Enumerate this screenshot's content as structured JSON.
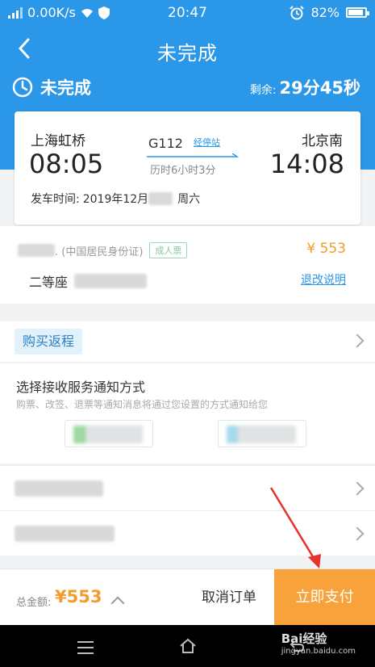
{
  "status_bar": {
    "network_speed": "0.00K/s",
    "time": "20:47",
    "battery": "82%",
    "battery_level": 0.82
  },
  "nav": {
    "title": "未完成"
  },
  "order_status": {
    "label": "未完成",
    "remaining_label": "剩余:",
    "remaining_time": "29分45秒"
  },
  "ticket": {
    "from_station": "上海虹桥",
    "from_time": "08:05",
    "to_station": "北京南",
    "to_time": "14:08",
    "train_no": "G112",
    "via_link": "经停站",
    "duration": "历时6小时3分",
    "depart_label": "发车时间:",
    "depart_date_prefix": "2019年12月",
    "depart_weekday": "周六"
  },
  "passenger": {
    "id_type": ". (中国居民身份证)",
    "ticket_type": "成人票",
    "price": "¥ 553",
    "seat_class": "二等座",
    "refund_link": "退改说明"
  },
  "return_trip": {
    "label": "购买返程"
  },
  "notify": {
    "title": "选择接收服务通知方式",
    "description": "购票、改签、退票等通知消息将通过您设置的方式通知给您"
  },
  "bottom_bar": {
    "total_label": "总金额:",
    "total_amount": "¥553",
    "cancel_label": "取消订单",
    "pay_label": "立即支付"
  },
  "watermark": {
    "brand": "Bai经验",
    "url": "jingyan.baidu.com"
  },
  "colors": {
    "primary_blue": "#2a97e8",
    "price_orange": "#f39b2c",
    "pay_button": "#f7a23a",
    "annotation_red": "#e8322c"
  }
}
